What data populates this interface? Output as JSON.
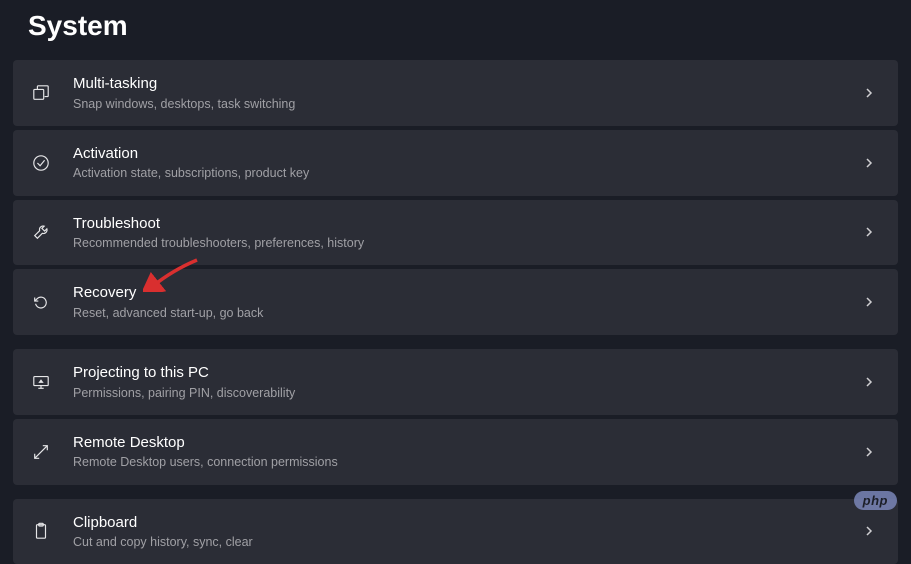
{
  "page": {
    "title": "System"
  },
  "items": [
    {
      "title": "Multi-tasking",
      "desc": "Snap windows, desktops, task switching",
      "icon": "multitasking"
    },
    {
      "title": "Activation",
      "desc": "Activation state, subscriptions, product key",
      "icon": "activation"
    },
    {
      "title": "Troubleshoot",
      "desc": "Recommended troubleshooters, preferences, history",
      "icon": "troubleshoot"
    },
    {
      "title": "Recovery",
      "desc": "Reset, advanced start-up, go back",
      "icon": "recovery"
    },
    {
      "title": "Projecting to this PC",
      "desc": "Permissions, pairing PIN, discoverability",
      "icon": "projecting"
    },
    {
      "title": "Remote Desktop",
      "desc": "Remote Desktop users, connection permissions",
      "icon": "remotedesktop"
    },
    {
      "title": "Clipboard",
      "desc": "Cut and copy history, sync, clear",
      "icon": "clipboard"
    }
  ],
  "badge": {
    "label": "php"
  }
}
